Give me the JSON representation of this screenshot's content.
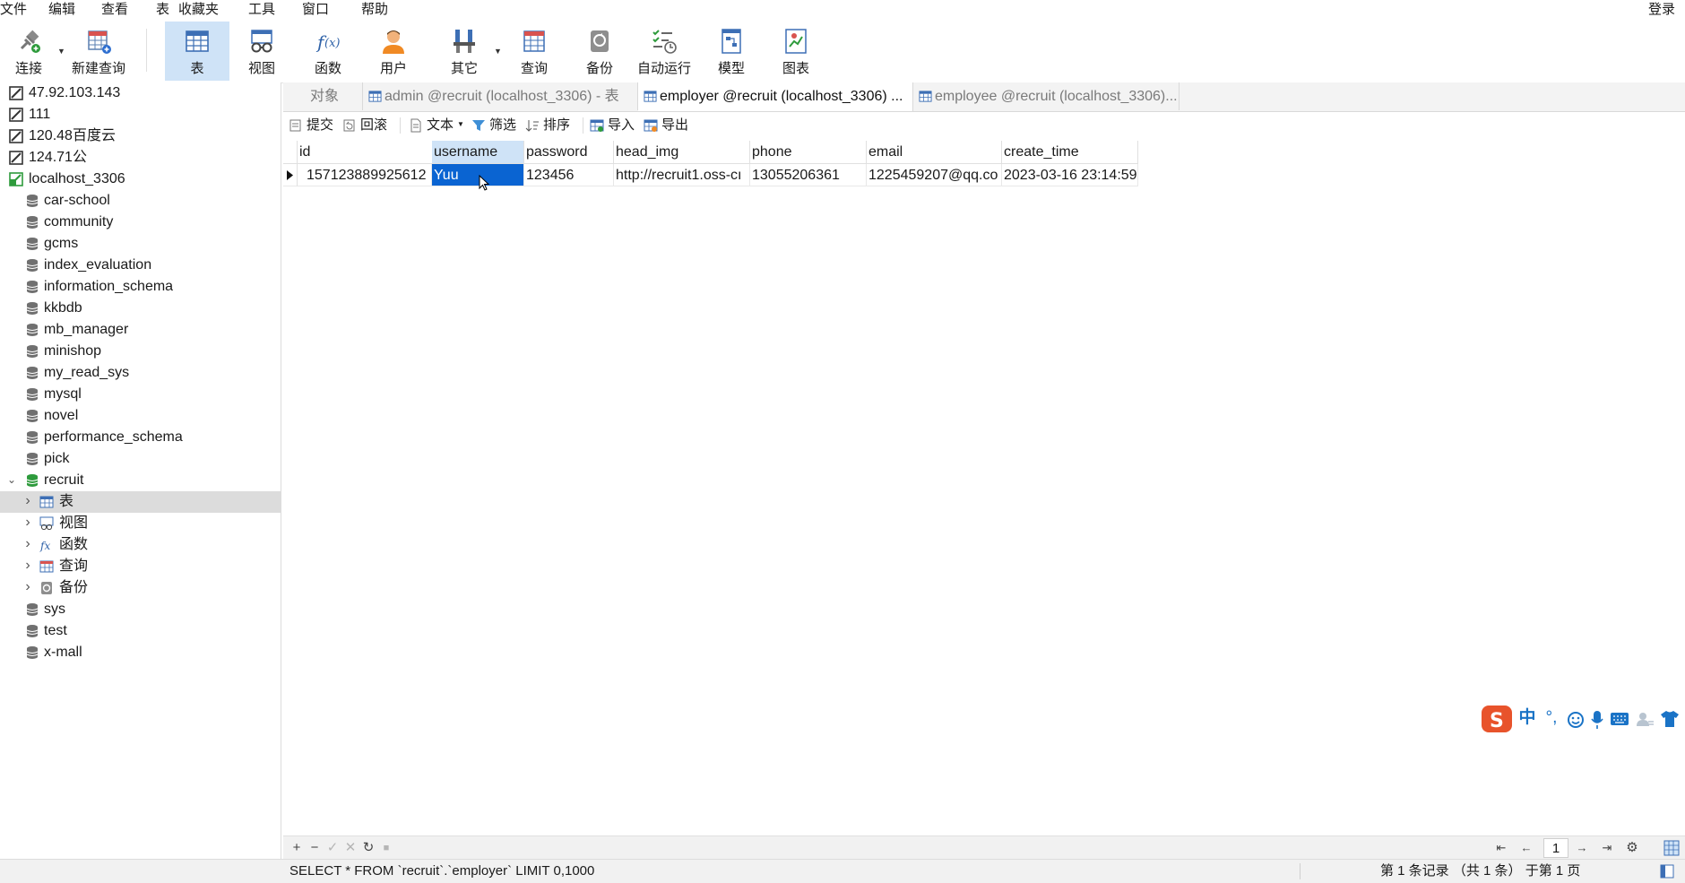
{
  "menubar": {
    "items": [
      "文件",
      "编辑",
      "查看",
      "表",
      "收藏夹",
      "工具",
      "窗口",
      "帮助"
    ],
    "login": "登录"
  },
  "toolbar": {
    "buttons": [
      {
        "label": "连接",
        "icon": "connection-plug-icon"
      },
      {
        "label": "新建查询",
        "icon": "new-query-icon"
      },
      {
        "label": "表",
        "icon": "table-icon"
      },
      {
        "label": "视图",
        "icon": "view-icon"
      },
      {
        "label": "函数",
        "icon": "function-fx-icon"
      },
      {
        "label": "用户",
        "icon": "user-icon"
      },
      {
        "label": "其它",
        "icon": "tools-icon"
      },
      {
        "label": "查询",
        "icon": "query-icon"
      },
      {
        "label": "备份",
        "icon": "backup-icon"
      },
      {
        "label": "自动运行",
        "icon": "auto-run-icon"
      },
      {
        "label": "模型",
        "icon": "model-icon"
      },
      {
        "label": "图表",
        "icon": "chart-icon"
      }
    ],
    "active": "表"
  },
  "sidebar": {
    "items": [
      {
        "label": "47.92.103.143",
        "type": "server"
      },
      {
        "label": "111",
        "type": "server"
      },
      {
        "label": "120.48百度云",
        "type": "server"
      },
      {
        "label": "124.71公",
        "type": "server"
      },
      {
        "label": "localhost_3306",
        "type": "server-connected"
      },
      {
        "label": "car-school",
        "type": "db"
      },
      {
        "label": "community",
        "type": "db"
      },
      {
        "label": "gcms",
        "type": "db"
      },
      {
        "label": "index_evaluation",
        "type": "db"
      },
      {
        "label": "information_schema",
        "type": "db"
      },
      {
        "label": "kkbdb",
        "type": "db"
      },
      {
        "label": "mb_manager",
        "type": "db"
      },
      {
        "label": "minishop",
        "type": "db"
      },
      {
        "label": "my_read_sys",
        "type": "db"
      },
      {
        "label": "mysql",
        "type": "db"
      },
      {
        "label": "novel",
        "type": "db"
      },
      {
        "label": "performance_schema",
        "type": "db"
      },
      {
        "label": "pick",
        "type": "db"
      },
      {
        "label": "recruit",
        "type": "db-open"
      },
      {
        "label": "表",
        "type": "child-table"
      },
      {
        "label": "视图",
        "type": "child-view"
      },
      {
        "label": "函数",
        "type": "child-function"
      },
      {
        "label": "查询",
        "type": "child-query"
      },
      {
        "label": "备份",
        "type": "child-backup"
      },
      {
        "label": "sys",
        "type": "db"
      },
      {
        "label": "test",
        "type": "db"
      },
      {
        "label": "x-mall",
        "type": "db"
      }
    ],
    "selected": "表"
  },
  "tabs": [
    {
      "label": "对象"
    },
    {
      "label": "admin @recruit (localhost_3306) - 表"
    },
    {
      "label": "employer @recruit (localhost_3306) ..."
    },
    {
      "label": "employee @recruit (localhost_3306)..."
    }
  ],
  "active_tab": "employer @recruit (localhost_3306) ...",
  "actions": [
    {
      "label": "提交",
      "icon": "commit-icon"
    },
    {
      "label": "回滚",
      "icon": "rollback-icon"
    },
    {
      "label": "文本",
      "icon": "text-icon"
    },
    {
      "label": "筛选",
      "icon": "filter-icon"
    },
    {
      "label": "排序",
      "icon": "sort-icon"
    },
    {
      "label": "导入",
      "icon": "import-icon"
    },
    {
      "label": "导出",
      "icon": "export-icon"
    }
  ],
  "grid": {
    "columns": [
      "id",
      "username",
      "password",
      "head_img",
      "phone",
      "email",
      "create_time"
    ],
    "rows": [
      [
        "157123889925612",
        "Yuu",
        "123456",
        "http://recruit1.oss-cı",
        "13055206361",
        "1225459207@qq.co",
        "2023-03-16 23:14:59"
      ]
    ],
    "selected_column": "username"
  },
  "bottombar": {
    "page": "1"
  },
  "statusbar": {
    "sql": "SELECT * FROM `recruit`.`employer` LIMIT 0,1000",
    "info": "第 1 条记录  （共 1 条）  于第 1 页"
  },
  "ime": {
    "items": [
      "中",
      "°,"
    ]
  },
  "colors": {
    "selection": "#0a64d2",
    "active_button": "#cfe3f7",
    "ime_logo": "#e8532b"
  }
}
